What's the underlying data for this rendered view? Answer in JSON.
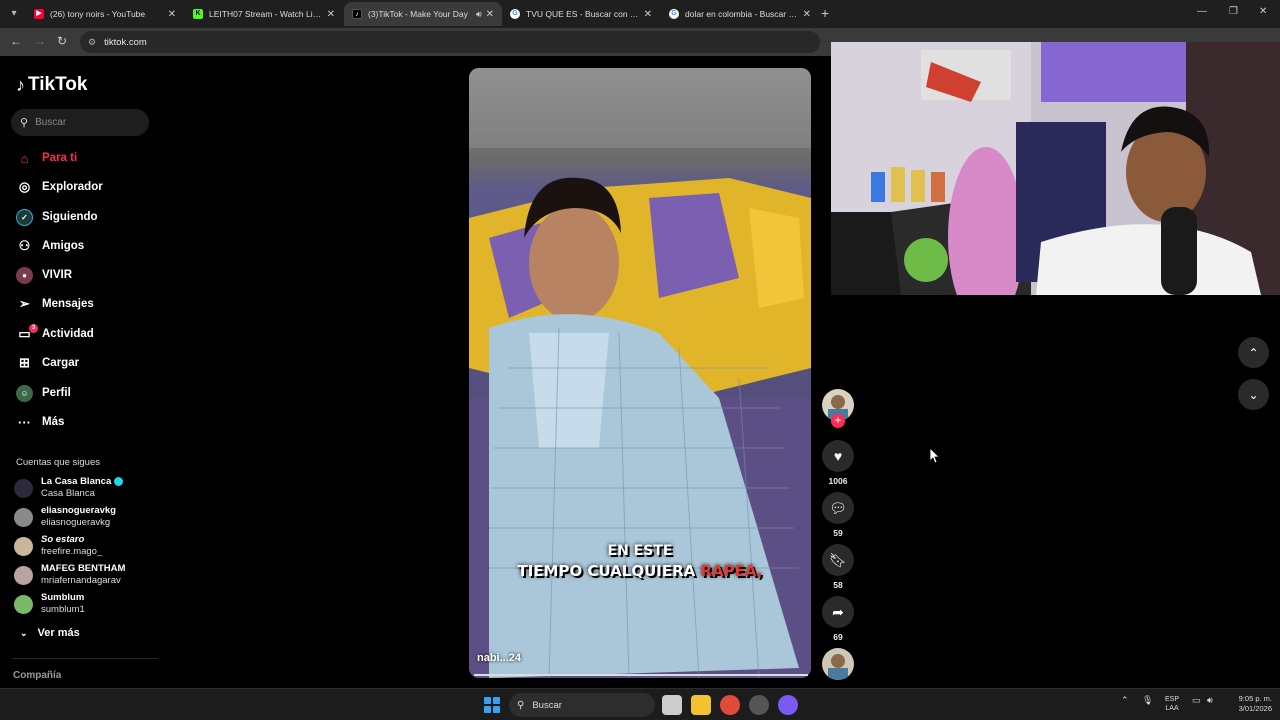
{
  "browser": {
    "tabs": [
      {
        "title": "(26) tony noirs - YouTube",
        "favicon_color": "#ff0033",
        "active": false
      },
      {
        "title": "LEITH07 Stream - Watch Live o",
        "favicon_color": "#53fc18",
        "active": false
      },
      {
        "title": "(3)TikTok - Make Your Day",
        "favicon_color": "#000000",
        "active": true
      },
      {
        "title": "TVU QUE ES - Buscar con Goog",
        "favicon_color": "#4285f4",
        "active": false
      },
      {
        "title": "dolar en colombia - Buscar con",
        "favicon_color": "#4285f4",
        "active": false
      }
    ],
    "url": "tiktok.com"
  },
  "sidebar": {
    "logo": "TikTok",
    "search_placeholder": "Buscar",
    "nav": [
      {
        "label": "Para ti",
        "icon": "home-icon",
        "active": true
      },
      {
        "label": "Explorador",
        "icon": "compass-icon"
      },
      {
        "label": "Siguiendo",
        "icon": "following-icon"
      },
      {
        "label": "Amigos",
        "icon": "friends-icon"
      },
      {
        "label": "VIVIR",
        "icon": "live-icon"
      },
      {
        "label": "Mensajes",
        "icon": "send-icon"
      },
      {
        "label": "Actividad",
        "icon": "activity-icon",
        "badge": "3"
      },
      {
        "label": "Cargar",
        "icon": "upload-icon"
      },
      {
        "label": "Perfil",
        "icon": "profile-icon"
      },
      {
        "label": "Más",
        "icon": "more-icon"
      }
    ],
    "following_header": "Cuentas que sigues",
    "following": [
      {
        "name": "La Casa Blanca",
        "handle": "Casa Blanca",
        "verified": true
      },
      {
        "name": "eliasnogueravkg",
        "handle": "eliasnogueravkg"
      },
      {
        "name": "So estaro",
        "handle": "freefire.mago_"
      },
      {
        "name": "MAFEG BENTHAM",
        "handle": "mriafernandagarav"
      },
      {
        "name": "Sumblum",
        "handle": "sumblum1"
      }
    ],
    "see_more": "Ver más",
    "company": "Compañía"
  },
  "video": {
    "caption_line1": "EN ESTE",
    "caption_line2_prefix": "TIEMPO CUALQUIERA ",
    "caption_line2_highlight": "RAPEA,",
    "username": "nabi...24",
    "progress": 1.0
  },
  "actions": {
    "likes": "1006",
    "comments": "59",
    "saves": "58",
    "shares": "69"
  },
  "taskbar": {
    "search_placeholder": "Buscar",
    "lang_line1": "ESP",
    "lang_line2": "LAA",
    "time": "9:05 p. m.",
    "date": "3/01/2026"
  }
}
